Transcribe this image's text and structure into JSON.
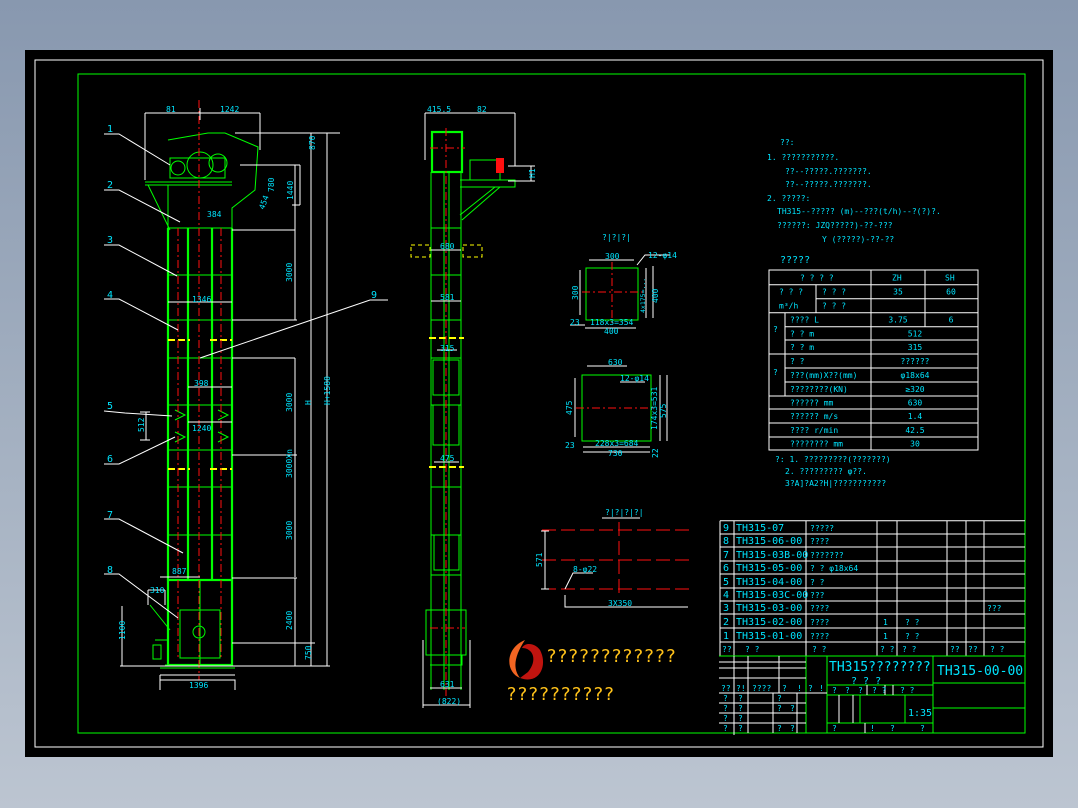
{
  "colors": {
    "background": "#000000",
    "frame": "#00ff00",
    "text": "#00e5ff",
    "dim": "#ffffff",
    "center": "#ff1010",
    "logo_text": "#ffc21a"
  },
  "elevation": {
    "leaders": [
      "1",
      "2",
      "3",
      "4",
      "5",
      "6",
      "7",
      "8",
      "9"
    ],
    "dims": {
      "top_left": "81",
      "top_right": "1242",
      "d870": "870",
      "d780": "780",
      "d1440": "1440",
      "d384": "384",
      "d3000": "3000",
      "d1346": "1346",
      "d398": "398",
      "d3000b": "3000",
      "d1240": "1240",
      "d512": "512",
      "d3000n": "3000Xn",
      "d3000c": "3000",
      "d887": "887",
      "d310": "310",
      "d1100": "1100",
      "d2400": "2400",
      "d750": "750",
      "d1396": "1396",
      "h": "H",
      "h_total": "H+1580",
      "d454": "454"
    }
  },
  "side_view": {
    "dims": {
      "d4155": "415.5",
      "d82": "82",
      "h1": "H1",
      "d680": "680",
      "d581": "581",
      "d315": "315",
      "d475": "475",
      "d631": "631",
      "d822": "(822)"
    }
  },
  "sections": {
    "s1": {
      "title": "?|?|?|",
      "d300": "300",
      "d12": "12-φ14",
      "d300v": "300",
      "d400v": "400",
      "d4x": "4x175=...",
      "d23": "23",
      "d118": "118x3=354",
      "d400": "400",
      "d23b": "23"
    },
    "s2": {
      "title": "",
      "d630": "630",
      "d12": "12-φ14",
      "d475": "475",
      "d4x": "174x3=531",
      "d575": "575",
      "d23": "23",
      "d228": "228x3=684",
      "d730": "730",
      "d22": "22"
    },
    "foundation": {
      "title": "?|?|?|?|",
      "d571": "571",
      "holes": "8-φ22",
      "d3x": "3X350"
    }
  },
  "notes": {
    "heading": "??:",
    "lines": [
      "1. ???????????.",
      "??--?????.???????.",
      "??--?????.???????.",
      "2. ?????:",
      "TH315--????? (m)--???(t/h)--?(?)?.",
      "??????:  JZQ?????)-??-???",
      "Y (?????)-??-??"
    ]
  },
  "spec": {
    "title": "?????",
    "header": [
      "? ? ? ?",
      "ZH",
      "SH"
    ],
    "rows": [
      {
        "g": "? ? ?",
        "g2": "m³/h",
        "k": "? ? ?",
        "a": "35",
        "b": "60"
      },
      {
        "k": "? ? ?",
        "a": "",
        "b": ""
      },
      {
        "g": "?",
        "k": "????    L",
        "a": "3.75",
        "b": "6"
      },
      {
        "k": "?   ?     m",
        "v": "512"
      },
      {
        "k": "?   ?     m",
        "v": "315"
      },
      {
        "g": "?",
        "k": "?          ?",
        "v": "??????"
      },
      {
        "k": "???(mm)X??(mm)",
        "v": "φ18x64"
      },
      {
        "k": "????????(KN)",
        "v": "≥320"
      },
      {
        "k": "??????     mm",
        "v": "630"
      },
      {
        "k": "??????     m/s",
        "v": "1.4"
      },
      {
        "k": "????       r/min",
        "v": "42.5"
      },
      {
        "k": "????????     mm",
        "v": "30"
      }
    ],
    "footnotes": [
      "?: 1. ?????????(???????)",
      "2. ?????????     φ??.",
      "3?A]?A2?H|???????????"
    ]
  },
  "parts": [
    {
      "no": "9",
      "code": "TH315-07",
      "name": "?????",
      "qty": "",
      "mat": "",
      "note": ""
    },
    {
      "no": "8",
      "code": "TH315-06-00",
      "name": "????",
      "qty": "",
      "mat": "",
      "note": ""
    },
    {
      "no": "7",
      "code": "TH315-03B-00",
      "name": "???????",
      "qty": "",
      "mat": "",
      "note": ""
    },
    {
      "no": "6",
      "code": "TH315-05-00",
      "name": "? ?  φ18x64",
      "qty": "",
      "mat": "",
      "note": ""
    },
    {
      "no": "5",
      "code": "TH315-04-00",
      "name": "? ?",
      "qty": "",
      "mat": "",
      "note": ""
    },
    {
      "no": "4",
      "code": "TH315-03C-00",
      "name": "???",
      "qty": "",
      "mat": "",
      "note": ""
    },
    {
      "no": "3",
      "code": "TH315-03-00",
      "name": "????",
      "qty": "",
      "mat": "",
      "note": "???"
    },
    {
      "no": "2",
      "code": "TH315-02-00",
      "name": "????",
      "qty": "1",
      "mat": "?   ?",
      "note": ""
    },
    {
      "no": "1",
      "code": "TH315-01-00",
      "name": "????",
      "qty": "1",
      "mat": "?   ?",
      "note": ""
    }
  ],
  "parts_header": [
    "??",
    "?     ?",
    "?          ?",
    "? ?",
    "?        ?",
    "??",
    "??",
    "?   ?"
  ],
  "title_block": {
    "title": "TH315????????",
    "subtitle": "?    ?    ?",
    "drawing_no": "TH315-00-00",
    "scale": "1:35",
    "cells": [
      "??",
      "?!",
      "????",
      "?",
      "!",
      "?",
      "!",
      "?",
      "?",
      "?",
      "?",
      "?",
      "?",
      "?",
      "?",
      "?",
      "?",
      "?",
      "?",
      "?",
      "?",
      "?",
      "?",
      "?",
      "?",
      "?",
      "? ?",
      "? ?",
      "?",
      "!",
      "?",
      "?"
    ]
  },
  "logo": {
    "line1": "????????????",
    "line2": "??????????",
    "icon": "flame-logo-icon"
  }
}
